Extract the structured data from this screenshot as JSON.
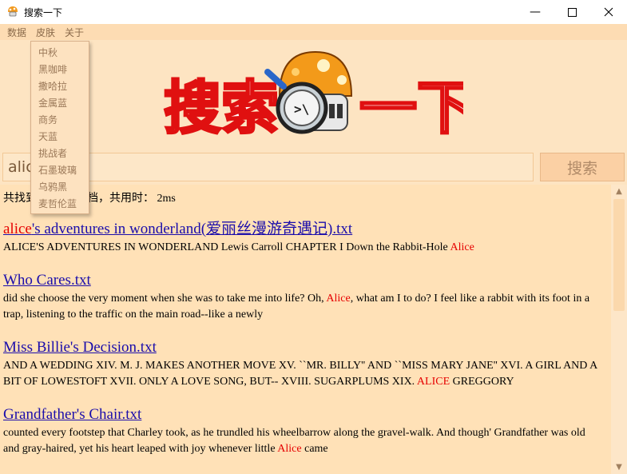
{
  "window": {
    "title": "搜索一下"
  },
  "menu": {
    "items": [
      "数据",
      "皮肤",
      "关于"
    ]
  },
  "skin_menu": {
    "items": [
      "中秋",
      "黑咖啡",
      "撒哈拉",
      "金属蓝",
      "商务",
      "天蓝",
      "挑战者",
      "石墨玻璃",
      "乌鸦黑",
      "麦哲伦蓝"
    ]
  },
  "logo": {
    "text_left": "搜索",
    "text_right": "一下"
  },
  "search": {
    "value": "alice",
    "button_label": "搜索"
  },
  "results": {
    "summary": "共找到4个相关文档，共用时： 2ms",
    "items": [
      {
        "title_hl": "alice",
        "title_rest": "'s adventures in wonderland(爱丽丝漫游奇遇记).txt",
        "snippet_pre": "ALICE'S ADVENTURES IN WONDERLAND Lewis Carroll CHAPTER I Down the Rabbit-Hole ",
        "snippet_hl": "Alice",
        "snippet_post": ""
      },
      {
        "title": "Who Cares.txt",
        "snippet_pre": "did she choose the very moment when she was to take me into life? Oh, ",
        "snippet_hl": "Alice",
        "snippet_post": ", what am I to do? I feel like a rabbit with its foot in a trap, listening to the traffic on the main road--like a newly"
      },
      {
        "title": "Miss Billie's Decision.txt",
        "snippet_pre": "AND A WEDDING XIV. M. J. MAKES ANOTHER MOVE XV. ``MR. BILLY'' AND ``MISS MARY JANE'' XVI. A GIRL AND A BIT OF LOWESTOFT XVII. ONLY A LOVE SONG, BUT-- XVIII. SUGARPLUMS XIX. ",
        "snippet_hl": "ALICE",
        "snippet_post": " GREGGORY"
      },
      {
        "title": "Grandfather's Chair.txt",
        "snippet_pre": "counted every footstep that Charley took, as he trundled his wheelbarrow along the gravel-walk. And though' Grandfather was old and gray-haired, yet his heart leaped with joy whenever little ",
        "snippet_hl": "Alice",
        "snippet_post": " came"
      }
    ]
  },
  "colors": {
    "accent": "#fddcb3",
    "highlight": "#e60000",
    "link": "#1a0dab"
  }
}
